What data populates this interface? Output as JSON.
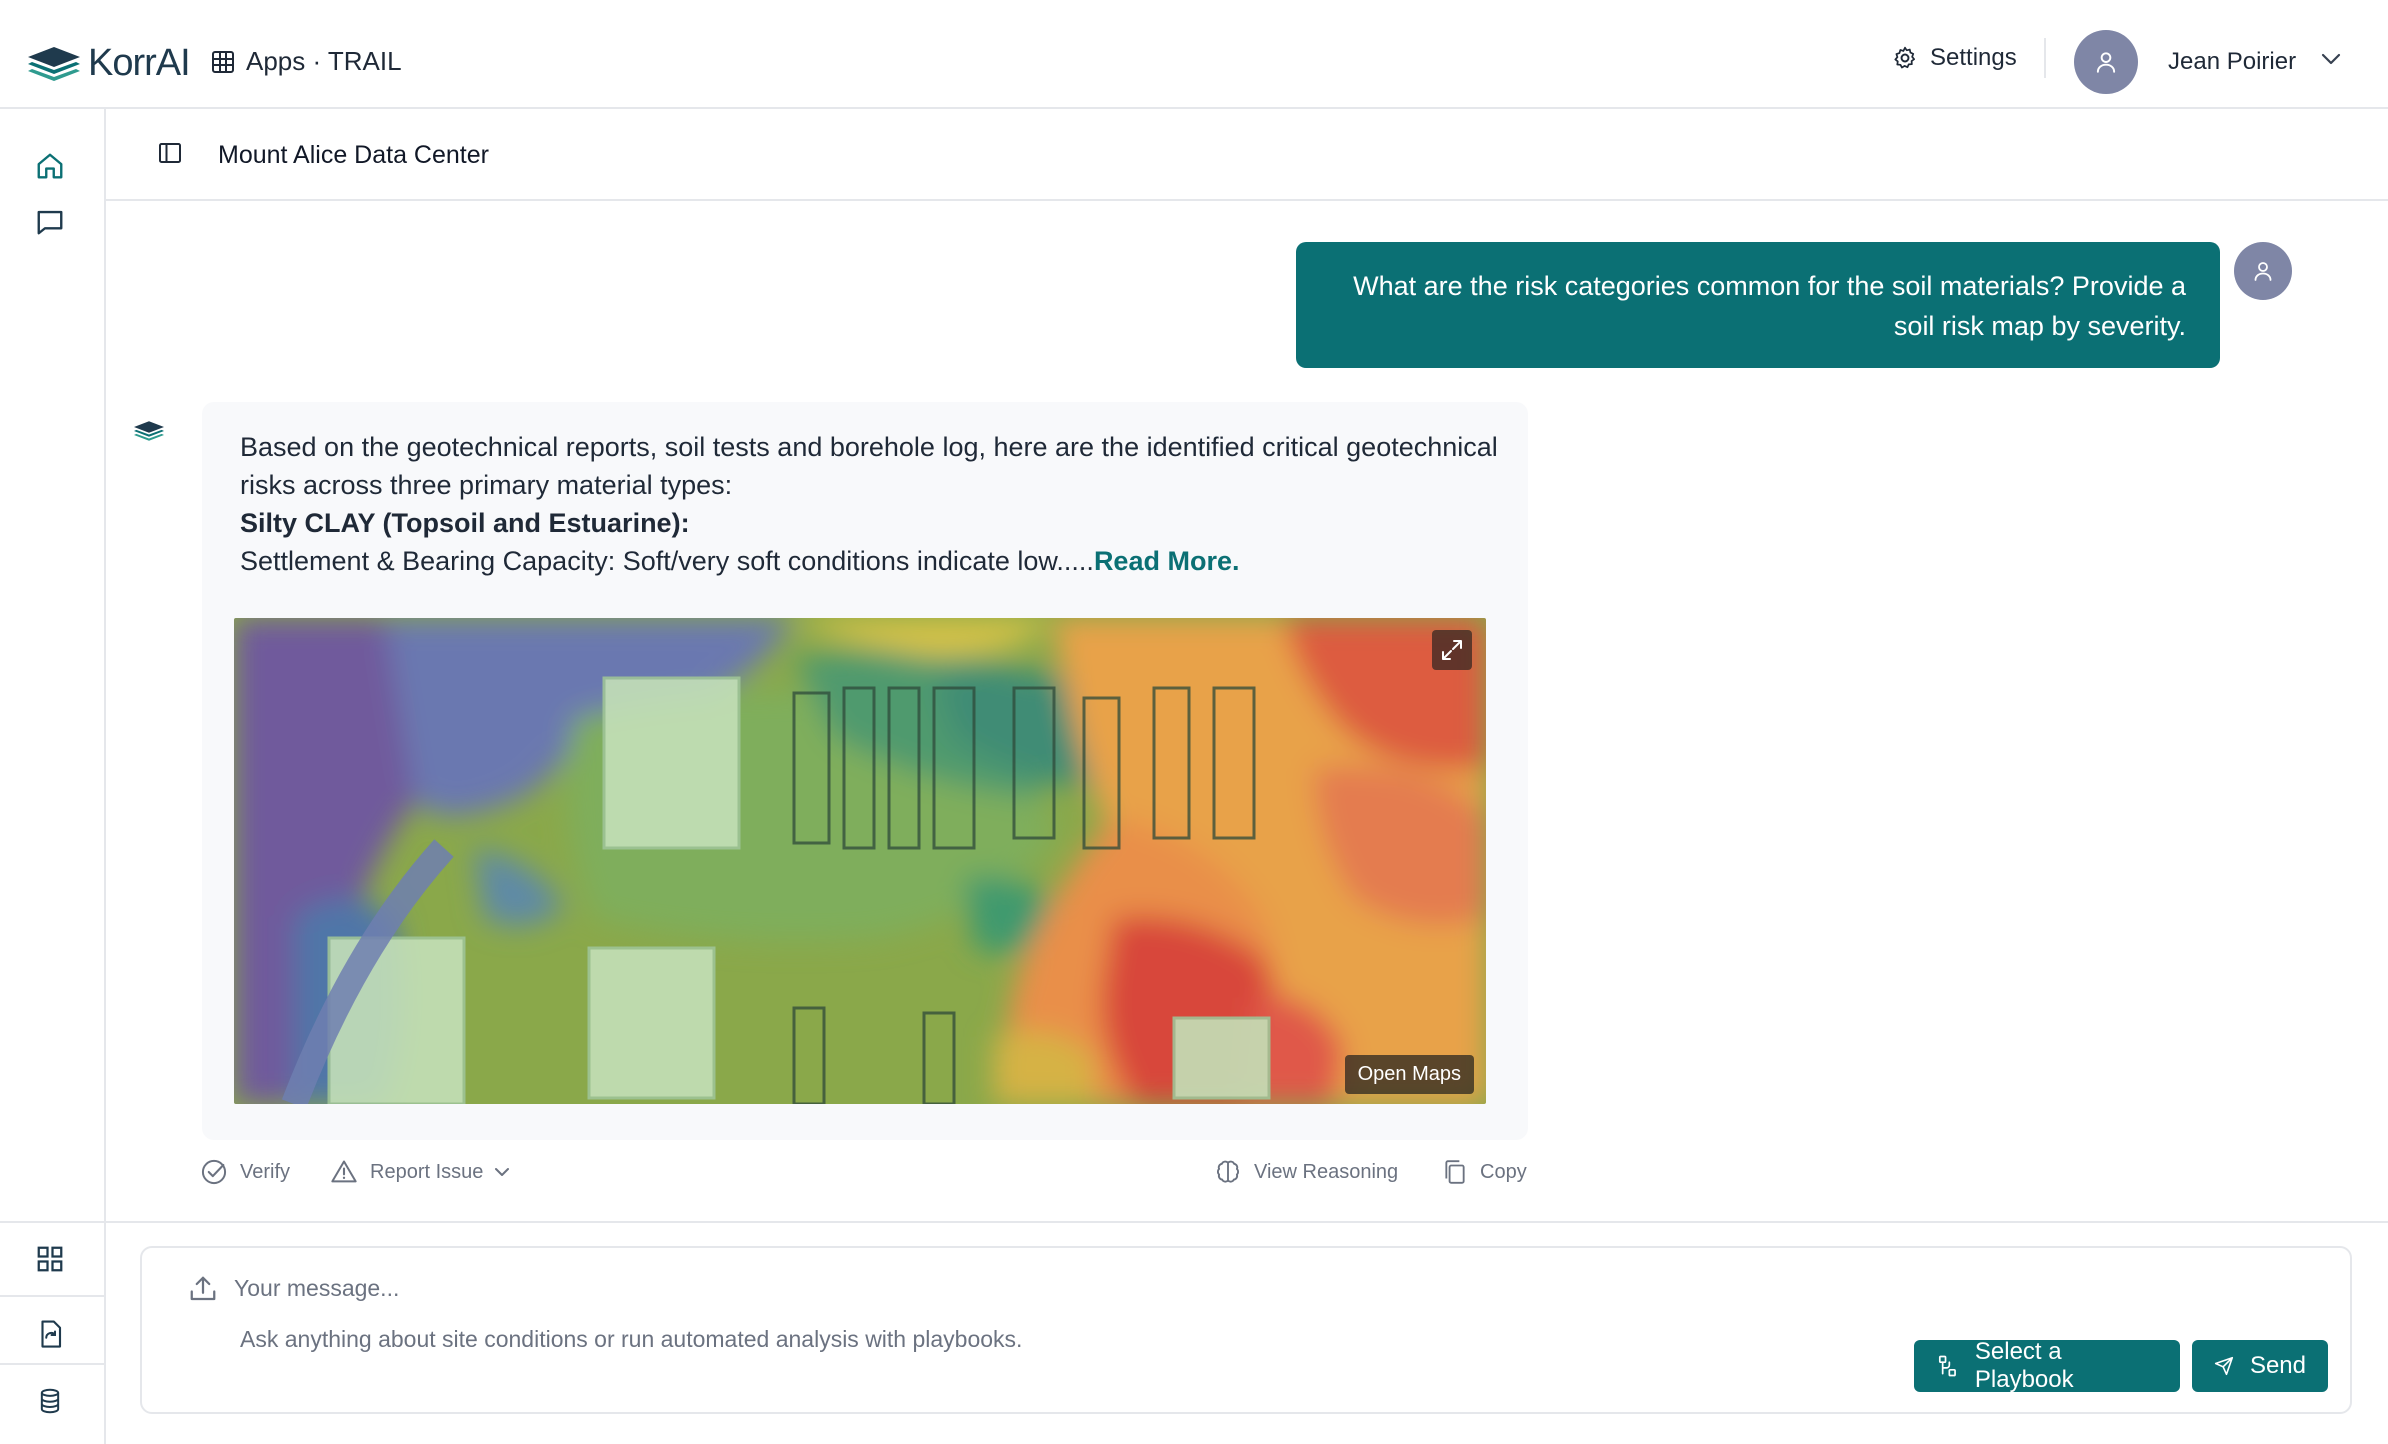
{
  "brand": {
    "name": "KorrAI",
    "accent": "#0b7074"
  },
  "topbar": {
    "apps_label": "Apps · TRAIL",
    "settings_label": "Settings",
    "user_name": "Jean Poirier"
  },
  "page": {
    "title": "Mount Alice Data Center"
  },
  "sidebar": {
    "icons": [
      "home-icon",
      "chat-icon",
      "grid-icon",
      "file-refresh-icon",
      "database-icon"
    ]
  },
  "chat": {
    "user_message": "What are the risk categories common for the soil materials? Provide a soil risk map by severity.",
    "bot": {
      "intro": "Based on the geotechnical reports, soil tests and borehole log, here are the identified critical geotechnical risks across three primary material types:",
      "heading": "Silty CLAY (Topsoil and Estuarine):",
      "preview": "Settlement & Bearing Capacity: Soft/very soft conditions indicate low.....",
      "read_more": "Read More.",
      "open_maps": "Open Maps"
    },
    "actions": {
      "verify": "Verify",
      "report_issue": "Report Issue",
      "view_reasoning": "View Reasoning",
      "copy": "Copy"
    }
  },
  "composer": {
    "placeholder": "Your message...",
    "hint": "Ask anything about site conditions or run automated analysis with playbooks.",
    "playbook_label": "Select a Playbook",
    "send_label": "Send"
  }
}
